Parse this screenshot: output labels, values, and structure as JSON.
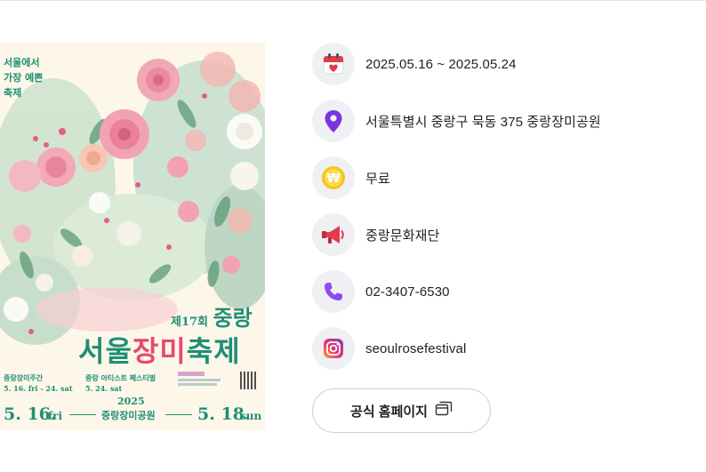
{
  "poster": {
    "tagline": [
      "서울에서",
      "가장 예쁜",
      "축제"
    ],
    "edition": "제17회",
    "region": "중랑",
    "title_part1": "서울",
    "title_part2": "장미",
    "title_part3": "축제",
    "week_label": "중랑장미주간",
    "week_dates": "5. 16. fri - 24. sat",
    "artist_label": "중랑 아티스트 페스티벌",
    "artist_date": "5. 24. sat",
    "year": "2025",
    "venue": "중랑장미공원",
    "start_date": "5. 16.",
    "start_day": "fri",
    "end_date": "5. 18.",
    "end_day": "sun"
  },
  "info": {
    "date": "2025.05.16 ~ 2025.05.24",
    "location": "서울특별시 중랑구 묵동 375 중랑장미공원",
    "fee": "무료",
    "organizer": "중랑문화재단",
    "phone": "02-3407-6530",
    "instagram": "seoulrosefestival"
  },
  "homepage_button": {
    "label": "공식 홈페이지"
  },
  "colors": {
    "teal": "#1f8f75",
    "rose": "#e44a73",
    "icon_bg": "#eff0f4",
    "pin": "#7b33e0",
    "phone": "#8a4cf0",
    "coin": "#f5c518",
    "calendar_red": "#e23b4e"
  },
  "icons": [
    "calendar-icon",
    "location-pin-icon",
    "won-coin-icon",
    "megaphone-icon",
    "phone-icon",
    "instagram-icon",
    "external-window-icon"
  ]
}
